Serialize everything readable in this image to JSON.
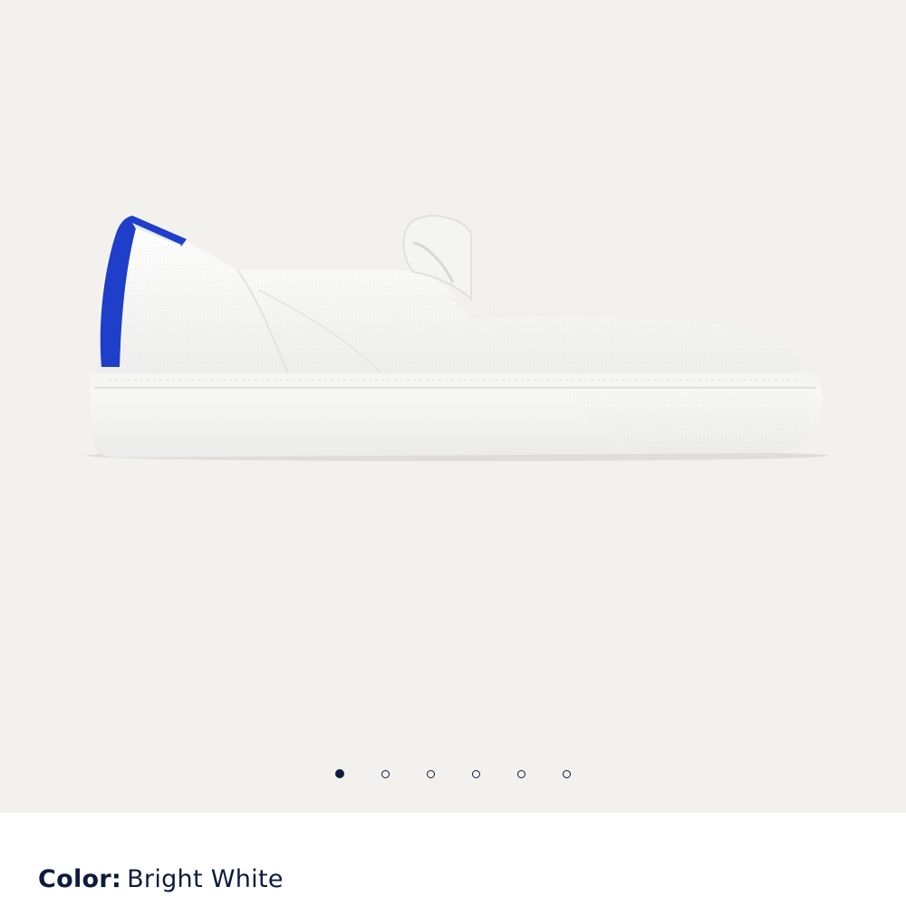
{
  "product": {
    "image_alt": "white knit slip-on sneaker",
    "color_label": "Color:",
    "color_value": "Bright White"
  },
  "gallery": {
    "slide_count": 6,
    "active_slide": 1
  },
  "colors": {
    "background": "#f2f1ee",
    "accent": "#1f3ec9",
    "text": "#0d1b3e"
  }
}
